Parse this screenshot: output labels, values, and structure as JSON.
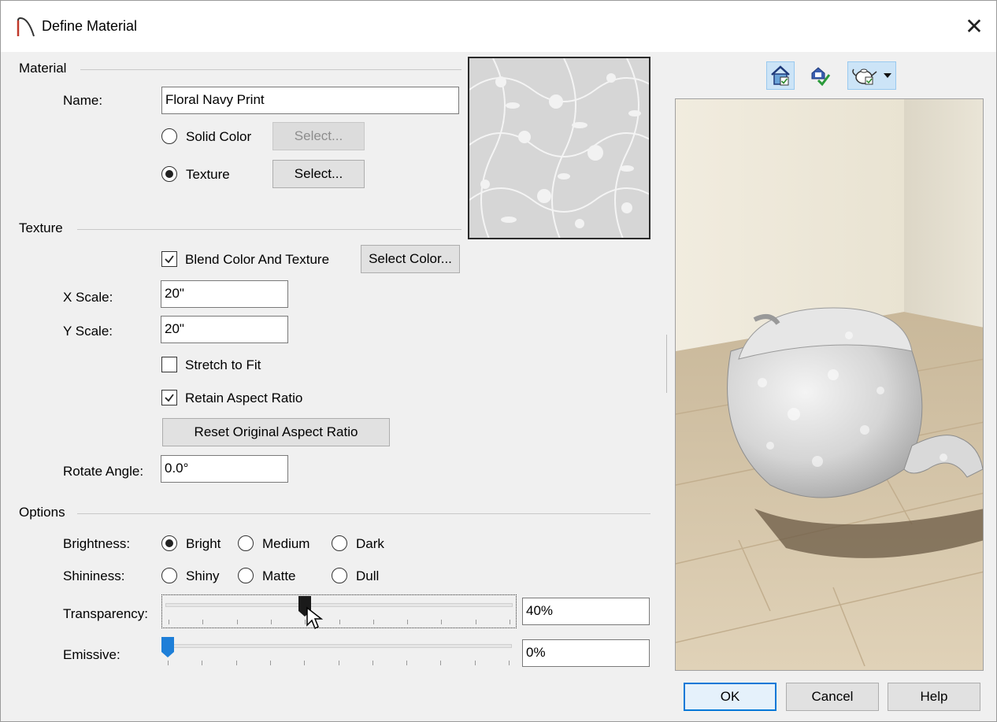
{
  "window": {
    "title": "Define Material",
    "close_icon": "close-icon"
  },
  "material": {
    "group_label": "Material",
    "name_label": "Name:",
    "name_value": "Floral Navy Print",
    "solid_color_label": "Solid Color",
    "solid_color_select": "Select...",
    "texture_label": "Texture",
    "texture_select": "Select...",
    "selected": "texture"
  },
  "texture": {
    "group_label": "Texture",
    "blend_label": "Blend Color And Texture",
    "blend_checked": true,
    "select_color": "Select Color...",
    "x_scale_label": "X Scale:",
    "x_scale_value": "20\"",
    "y_scale_label": "Y Scale:",
    "y_scale_value": "20\"",
    "stretch_label": "Stretch to Fit",
    "stretch_checked": false,
    "retain_label": "Retain Aspect Ratio",
    "retain_checked": true,
    "reset_button": "Reset Original Aspect Ratio",
    "rotate_label": "Rotate Angle:",
    "rotate_value": "0.0°"
  },
  "options": {
    "group_label": "Options",
    "brightness_label": "Brightness:",
    "brightness_options": [
      "Bright",
      "Medium",
      "Dark"
    ],
    "brightness_selected": "Bright",
    "shininess_label": "Shininess:",
    "shininess_options": [
      "Shiny",
      "Matte",
      "Dull"
    ],
    "shininess_selected": "",
    "transparency_label": "Transparency:",
    "transparency_value": "40%",
    "transparency_fraction": 0.4,
    "emissive_label": "Emissive:",
    "emissive_value": "0%",
    "emissive_fraction": 0.0
  },
  "preview_toolbar": {
    "icons": [
      "house-material-icon",
      "apply-check-icon",
      "teapot-preview-icon",
      "dropdown-arrow-icon"
    ]
  },
  "footer": {
    "ok": "OK",
    "cancel": "Cancel",
    "help": "Help"
  },
  "colors": {
    "accent": "#0078d7",
    "slider_thumb_blue": "#1e7fd8",
    "slider_thumb_dark": "#1a1a1a"
  }
}
